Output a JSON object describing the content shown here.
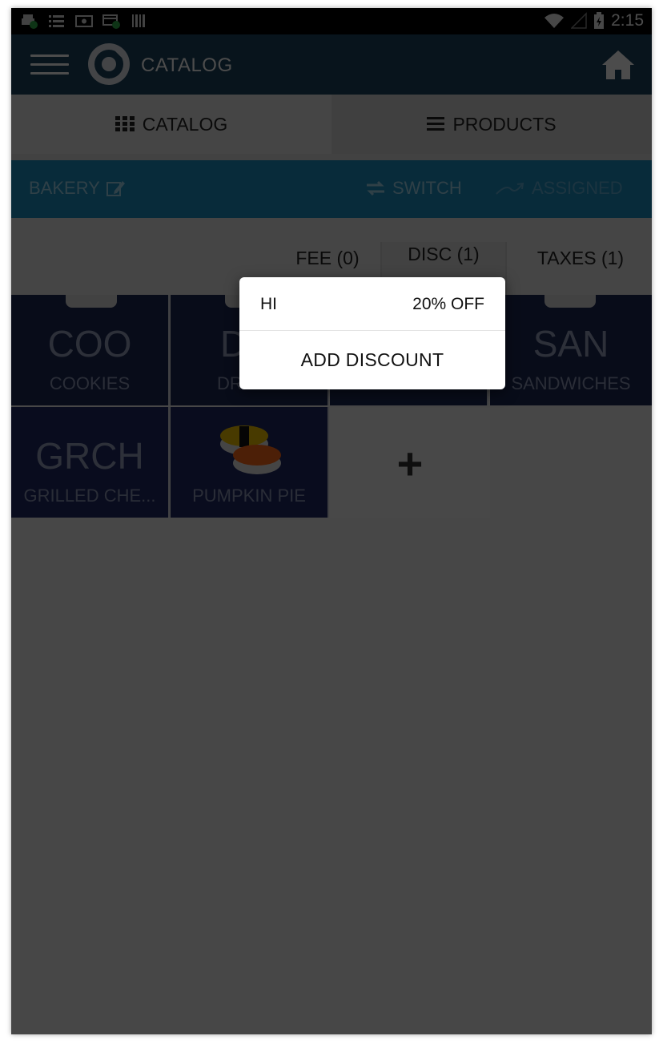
{
  "status_bar": {
    "time": "2:15"
  },
  "app_bar": {
    "title": "CATALOG"
  },
  "tabs": [
    {
      "label": "CATALOG",
      "icon": "grid-icon"
    },
    {
      "label": "PRODUCTS",
      "icon": "list-icon"
    }
  ],
  "category_bar": {
    "category": "BAKERY",
    "switch_label": "SWITCH",
    "assigned_label": "ASSIGNED"
  },
  "filters": {
    "fee": "FEE (0)",
    "disc": "DISC (1)",
    "taxes": "TAXES (1)"
  },
  "tiles": [
    {
      "abbr": "COO",
      "name": "COOKIES"
    },
    {
      "abbr": "D",
      "name": "DR"
    },
    {
      "abbr": "",
      "name": ""
    },
    {
      "abbr": "SAN",
      "name": "SANDWICHES"
    },
    {
      "abbr": "GRCH",
      "name": "GRILLED CHE..."
    },
    {
      "abbr": "",
      "name": "PUMPKIN PIE"
    }
  ],
  "popup": {
    "discount_name": "HI",
    "discount_value": "20% OFF",
    "add_label": "ADD DISCOUNT"
  },
  "colors": {
    "app_bar": "#1c445f",
    "category_bar": "#1d8fc4",
    "tile": "#1d2a55"
  }
}
